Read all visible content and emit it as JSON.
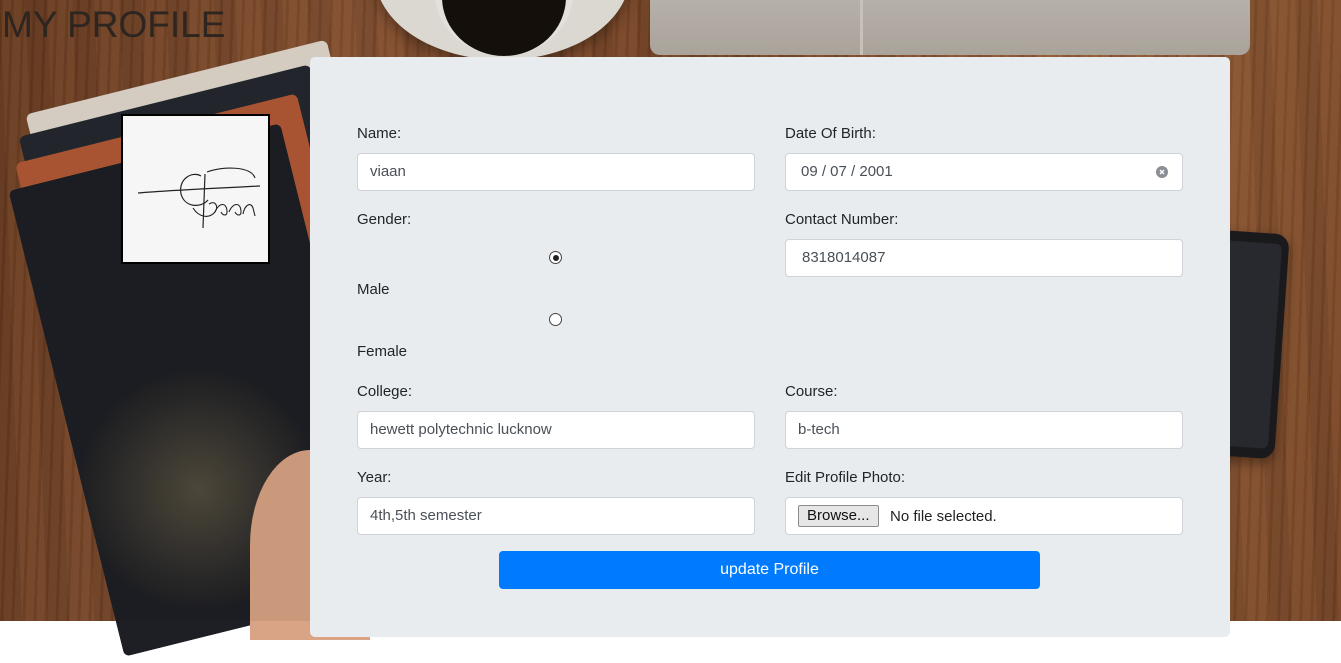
{
  "page": {
    "title": "MY PROFILE"
  },
  "form": {
    "name": {
      "label": "Name:",
      "value": "viaan"
    },
    "dob": {
      "label": "Date Of Birth:",
      "value": "09 / 07 / 2001"
    },
    "gender": {
      "label": "Gender:",
      "options": [
        {
          "label": "Male",
          "checked": true
        },
        {
          "label": "Female",
          "checked": false
        }
      ]
    },
    "contact": {
      "label": "Contact Number:",
      "value": "8318014087"
    },
    "college": {
      "label": "College:",
      "value": "hewett polytechnic lucknow"
    },
    "course": {
      "label": "Course:",
      "value": "b-tech"
    },
    "year": {
      "label": "Year:",
      "value": "4th,5th semester"
    },
    "photo": {
      "label": "Edit Profile Photo:",
      "browse_label": "Browse...",
      "status": "No file selected."
    },
    "submit_label": "update Profile"
  },
  "colors": {
    "card_bg": "#e9ecef",
    "primary": "#007bff"
  },
  "icons": {
    "dob_clear": "clear-circle-icon",
    "profile_photo": "signature-image"
  }
}
